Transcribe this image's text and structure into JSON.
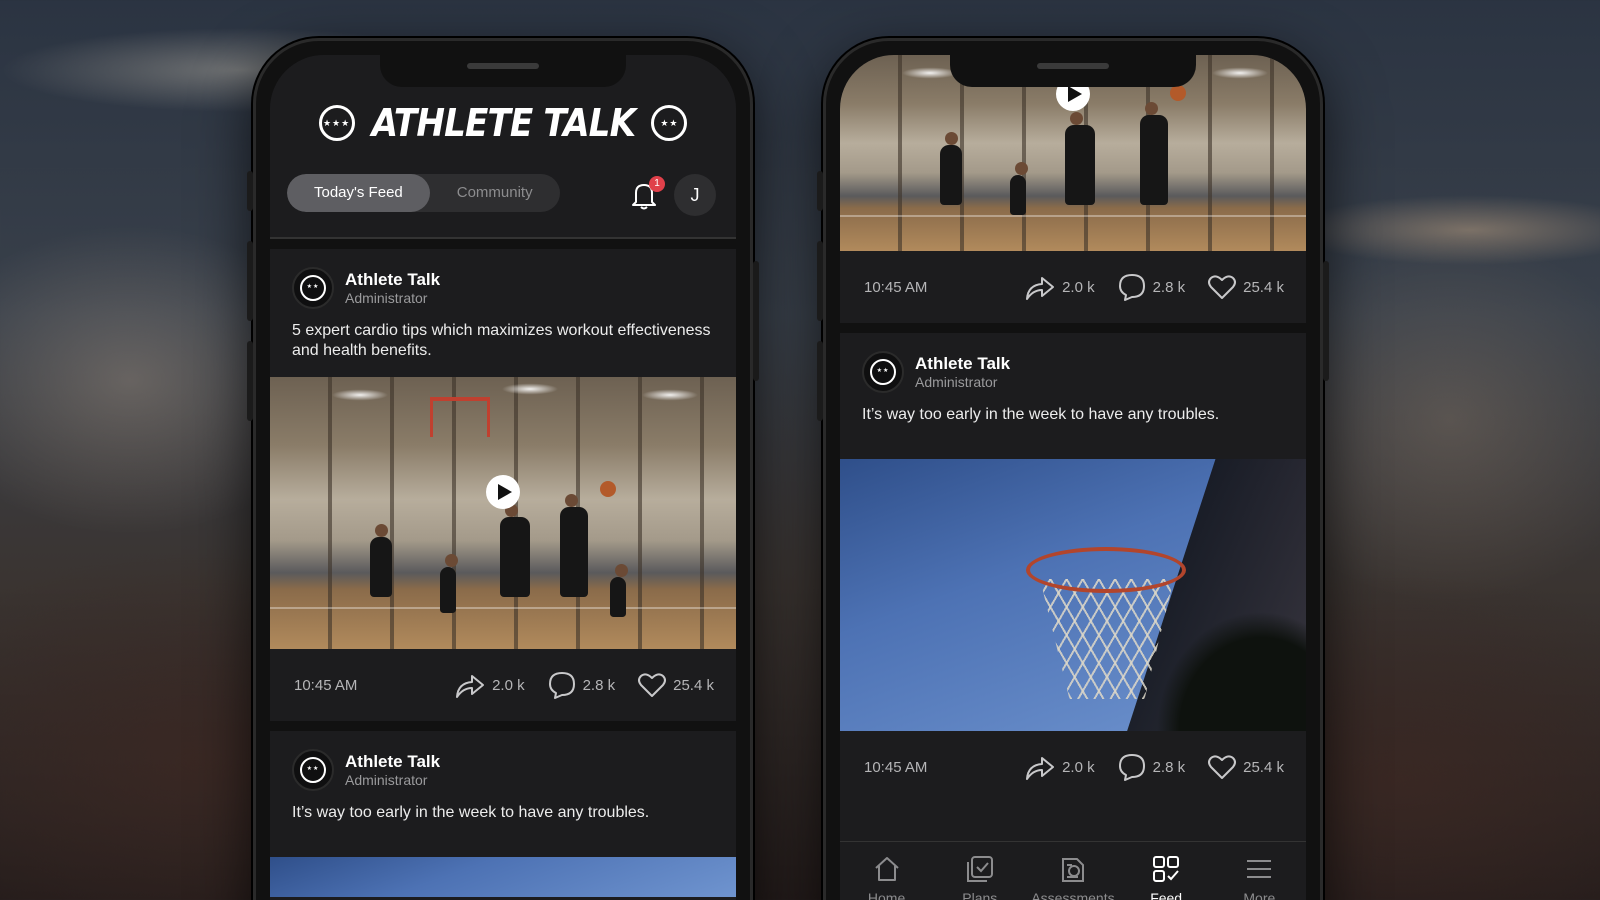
{
  "app": {
    "logo_text": "ATHLETE TALK",
    "tabs": [
      "Today's Feed",
      "Community"
    ],
    "active_tab": "Today's Feed",
    "notification_count": "1",
    "user_initial": "J"
  },
  "left_phone": {
    "posts": [
      {
        "author": "Athlete Talk",
        "role": "Administrator",
        "text": "5 expert cardio tips which maximizes workout effectiveness and health benefits.",
        "media": "video",
        "time": "10:45 AM",
        "shares": "2.0 k",
        "comments": "2.8 k",
        "likes": "25.4 k"
      },
      {
        "author": "Athlete Talk",
        "role": "Administrator",
        "text": "It’s way too early in the week to have any troubles."
      }
    ]
  },
  "right_phone": {
    "top_post": {
      "time": "10:45 AM",
      "shares": "2.0 k",
      "comments": "2.8 k",
      "likes": "25.4 k"
    },
    "post": {
      "author": "Athlete Talk",
      "role": "Administrator",
      "text": "It’s way too early in the week to have any troubles.",
      "media": "image",
      "time": "10:45 AM",
      "shares": "2.0 k",
      "comments": "2.8 k",
      "likes": "25.4 k"
    },
    "nav": [
      {
        "label": "Home",
        "icon": "home-icon"
      },
      {
        "label": "Plans",
        "icon": "plans-icon"
      },
      {
        "label": "Assessments",
        "icon": "assessments-icon"
      },
      {
        "label": "Feed",
        "icon": "feed-icon",
        "active": true
      },
      {
        "label": "More",
        "icon": "menu-icon"
      }
    ]
  },
  "colors": {
    "background": "#1c1c1e",
    "badge": "#e0404a",
    "active_tab": "#5e5e62"
  }
}
